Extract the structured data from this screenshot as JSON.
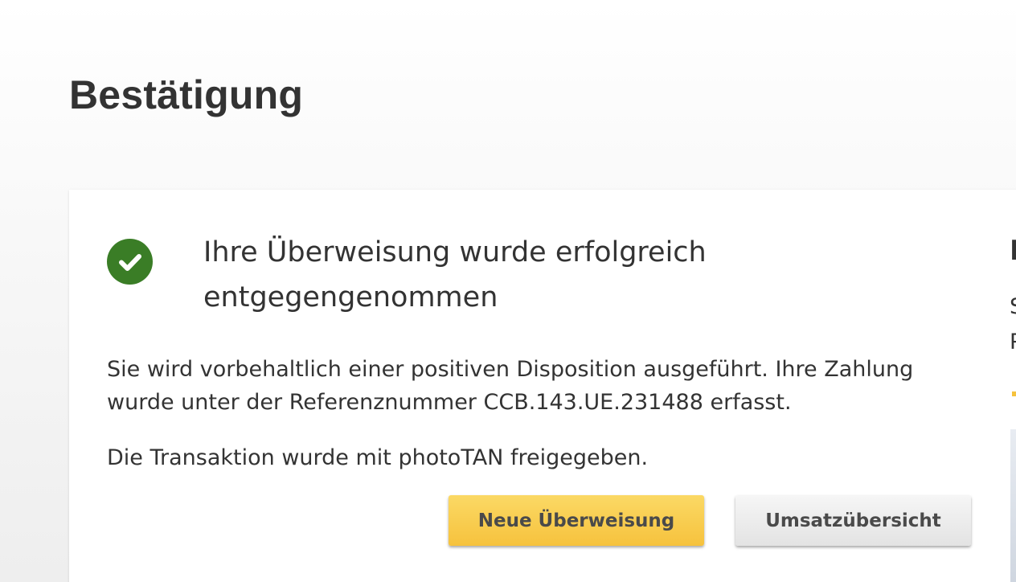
{
  "page": {
    "title": "Bestätigung"
  },
  "confirmation": {
    "icon": "check-circle-icon",
    "success_color": "#3a7d26",
    "headline": "Ihre Überweisung wurde erfolgreich entgegengenommen",
    "info_text": "Sie wird vorbehaltlich einer positiven Disposition ausgeführt. Ihre Zahlung wurde unter der Referenznummer CCB.143.UE.231488 erfasst.",
    "tan_text": "Die Transaktion wurde mit photoTAN freigegeben."
  },
  "actions": {
    "new_transfer_label": "Neue Überweisung",
    "transactions_label": "Umsatzübersicht",
    "primary_color": "#f6c23d"
  },
  "side_panel": {
    "heading_fragment": "I",
    "text_line_1": "S",
    "text_line_2": "P"
  }
}
